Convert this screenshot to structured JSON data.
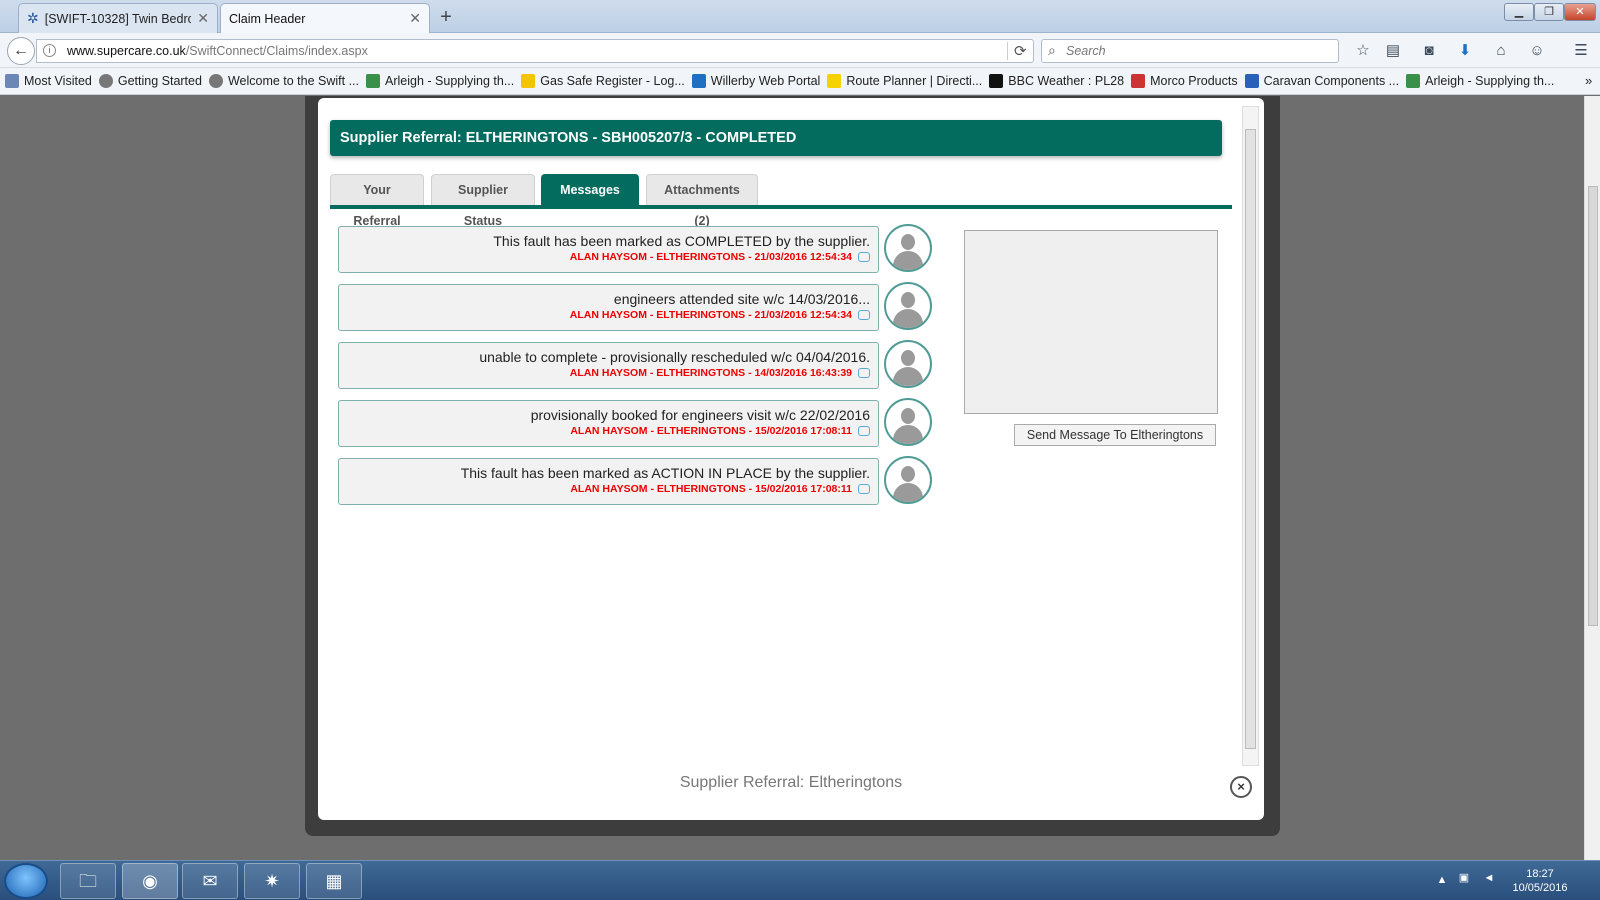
{
  "browser": {
    "tabs": [
      {
        "title": "[SWIFT-10328] Twin Bedro...",
        "active": false
      },
      {
        "title": "Claim Header",
        "active": true
      }
    ],
    "url_domain": "www.supercare.co.uk",
    "url_path": "/SwiftConnect/Claims/index.aspx",
    "search_placeholder": "Search",
    "bookmarks": [
      "Most Visited",
      "Getting Started",
      "Welcome to the Swift ...",
      "Arleigh - Supplying th...",
      "Gas Safe Register - Log...",
      "Willerby Web Portal",
      "Route Planner | Directi...",
      "BBC Weather : PL28",
      "Morco Products",
      "Caravan Components ...",
      "Arleigh - Supplying th..."
    ],
    "bookmark_overflow": "»"
  },
  "modal": {
    "header": "Supplier Referral: ELTHERINGTONS - SBH005207/3 - COMPLETED",
    "tabs": [
      "Your Referral",
      "Supplier Status",
      "Messages (5)",
      "Attachments (2)"
    ],
    "selected_tab": "Messages (5)",
    "messages": [
      {
        "text": "This fault has been marked as COMPLETED by the supplier.",
        "meta": "ALAN HAYSOM - ELTHERINGTONS - 21/03/2016 12:54:34"
      },
      {
        "text": "engineers attended site w/c 14/03/2016...",
        "meta": "ALAN HAYSOM - ELTHERINGTONS - 21/03/2016 12:54:34"
      },
      {
        "text": "unable to complete - provisionally rescheduled w/c 04/04/2016.",
        "meta": "ALAN HAYSOM - ELTHERINGTONS - 14/03/2016 16:43:39"
      },
      {
        "text": "provisionally booked for engineers visit w/c 22/02/2016",
        "meta": "ALAN HAYSOM - ELTHERINGTONS - 15/02/2016 17:08:11"
      },
      {
        "text": "This fault has been marked as ACTION IN PLACE by the supplier.",
        "meta": "ALAN HAYSOM - ELTHERINGTONS - 15/02/2016 17:08:11"
      }
    ],
    "send_button": "Send Message To Eltheringtons",
    "footer": "Supplier Referral: Eltheringtons",
    "close_label": "×"
  },
  "taskbar": {
    "time": "18:27",
    "date": "10/05/2016"
  },
  "colors": {
    "accent": "#046b5f",
    "meta_text": "#ee0000"
  }
}
